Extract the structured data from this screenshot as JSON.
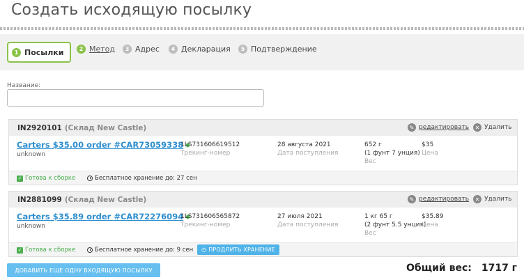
{
  "page_title": "Создать исходящую посылку",
  "steps": [
    {
      "num": "1",
      "label": "Посылки"
    },
    {
      "num": "2",
      "label": "Метод"
    },
    {
      "num": "3",
      "label": "Адрес"
    },
    {
      "num": "4",
      "label": "Декларация"
    },
    {
      "num": "5",
      "label": "Подтверждение"
    }
  ],
  "name_field": {
    "label": "Название:",
    "value": "",
    "placeholder": ""
  },
  "parcels": [
    {
      "id": "IN2920101",
      "warehouse": "(Склад New Castle)",
      "edit_label": "редактировать",
      "delete_label": "Удалить",
      "order": "Carters $35.00 order #CAR73059338",
      "status_word": "unknown",
      "tracking": "1LS731606619512",
      "tracking_label": "Трекинг-номер",
      "date": "28 августа 2021",
      "date_label": "Дата поступления",
      "weight_1": "652 г",
      "weight_2": "(1 фунт 7 унция)",
      "weight_label": "Вес",
      "price": "$35",
      "price_label": "Цена",
      "ready_label": "Готова к сборке",
      "storage_text": "Бесплатное хранение до: 27 сен"
    },
    {
      "id": "IN2881099",
      "warehouse": "(Склад New Castle)",
      "edit_label": "редактировать",
      "delete_label": "Удалить",
      "order": "Carters $35.89 order #CAR72276094",
      "status_word": "unknown",
      "tracking": "1LS731606565872",
      "tracking_label": "Трекинг-номер",
      "date": "27 июля 2021",
      "date_label": "Дата поступления",
      "weight_1": "1 кг 65 г",
      "weight_2": "(2 фунт 5.5 унция)",
      "weight_label": "Вес",
      "price": "$35.89",
      "price_label": "Цена",
      "ready_label": "Готова к сборке",
      "storage_text": "Бесплатное хранение до: 9 сен",
      "extend_label": "ПРОДЛИТЬ ХРАНЕНИЕ"
    }
  ],
  "add_button_label": "ДОБАВИТЬ ЕЩЕ ОДНУ ВХОДЯЩУЮ ПОСЫЛКУ",
  "total_label": "Общий вес:",
  "total_value": "1717 г",
  "colors": {
    "accent_green": "#8bc34a",
    "link_blue": "#2e8fd0",
    "button_blue": "#67bff0"
  }
}
